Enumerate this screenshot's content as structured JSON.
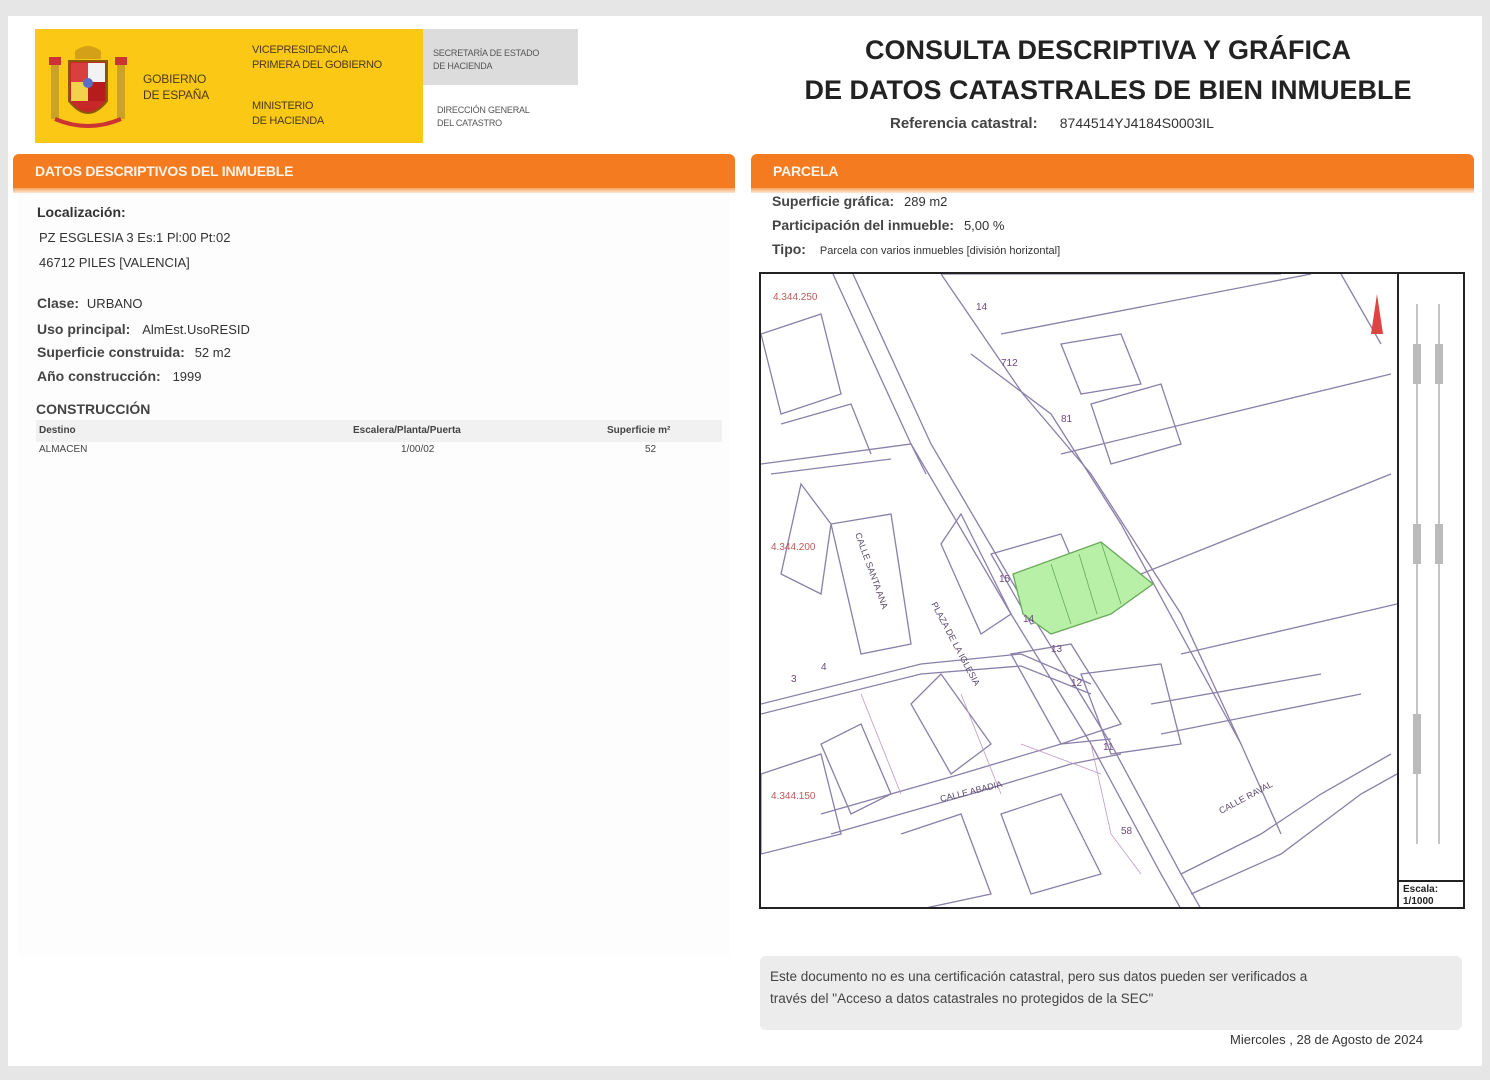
{
  "header": {
    "gobierno": [
      "GOBIERNO",
      "DE ESPAÑA"
    ],
    "vicepresidencia": [
      "VICEPRESIDENCIA",
      "PRIMERA DEL GOBIERNO"
    ],
    "ministerio": [
      "MINISTERIO",
      "DE HACIENDA"
    ],
    "secretaria": [
      "SECRETARÍA DE ESTADO",
      "DE HACIENDA"
    ],
    "direccion": [
      "DIRECCIÓN GENERAL",
      "DEL CATASTRO"
    ],
    "title_line1": "CONSULTA DESCRIPTIVA Y GRÁFICA",
    "title_line2": "DE DATOS CATASTRALES DE BIEN INMUEBLE",
    "ref_label": "Referencia catastral:",
    "ref_value": "8744514YJ4184S0003IL"
  },
  "left": {
    "section_title": "DATOS DESCRIPTIVOS DEL INMUEBLE",
    "localizacion_label": "Localización:",
    "address_line1": "PZ ESGLESIA 3 Es:1 Pl:00 Pt:02",
    "address_line2": "46712 PILES [VALENCIA]",
    "clase_label": "Clase:",
    "clase_value": "URBANO",
    "uso_label": "Uso principal:",
    "uso_value": "AlmEst.UsoRESID",
    "superficie_label": "Superficie construida:",
    "superficie_value": "52 m2",
    "anio_label": "Año construcción:",
    "anio_value": "1999",
    "construccion_title": "CONSTRUCCIÓN",
    "table_headers": [
      "Destino",
      "Escalera/Planta/Puerta",
      "Superficie m²"
    ],
    "table_rows": [
      [
        "ALMACEN",
        "1/00/02",
        "52"
      ]
    ]
  },
  "right": {
    "section_title": "PARCELA",
    "sup_grafica_label": "Superficie gráfica:",
    "sup_grafica_value": "289 m2",
    "participacion_label": "Participación del inmueble:",
    "participacion_value": "5,00 %",
    "tipo_label": "Tipo:",
    "tipo_value": "Parcela con varios inmuebles [división horizontal]",
    "scale_label": "Escala:",
    "scale_value": "1/1000"
  },
  "footer": {
    "disclaimer_line1": "Este documento no es una certificación catastral, pero sus datos pueden ser verificados a",
    "disclaimer_line2": "través del \"Acceso a datos catastrales no protegidos de la SEC\"",
    "date": "Miercoles , 28 de Agosto de 2024"
  },
  "colors": {
    "accent_orange": "#f47b20",
    "logo_yellow": "#fcc816",
    "parcel_fill": "#b8f0a8"
  }
}
